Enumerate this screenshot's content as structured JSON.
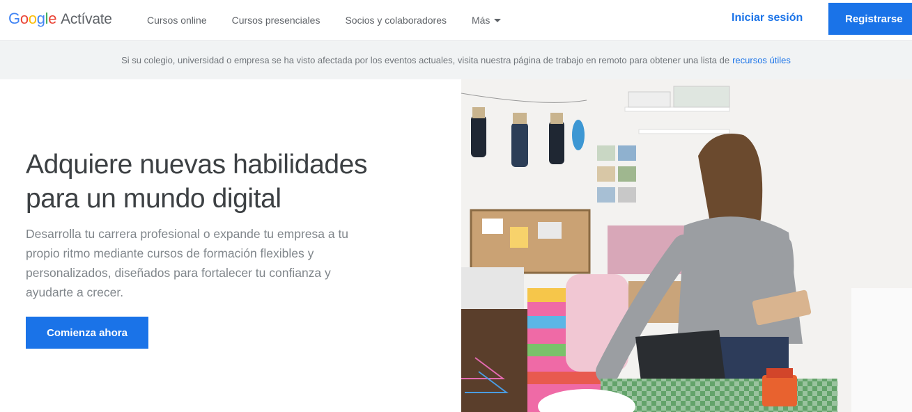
{
  "logo": {
    "letters": [
      "G",
      "o",
      "o",
      "g",
      "l",
      "e"
    ],
    "product": "Actívate"
  },
  "nav": {
    "items": [
      {
        "label": "Cursos online"
      },
      {
        "label": "Cursos presenciales"
      },
      {
        "label": "Socios y colaboradores"
      },
      {
        "label": "Más"
      }
    ],
    "signin_label": "Iniciar sesión",
    "register_label": "Registrarse"
  },
  "banner": {
    "text": "Si su colegio, universidad o empresa se ha visto afectada por los eventos actuales, visita nuestra página de trabajo en remoto para obtener una lista de",
    "link": "recursos útiles"
  },
  "hero": {
    "title_line1": "Adquiere nuevas habilidades",
    "title_line2": "para un mundo digital",
    "description": "Desarrolla tu carrera profesional o expande tu empresa a tu propio ritmo mediante cursos de formación flexibles y personalizados, diseñados para fortalecer tu confianza y ayudarte a crecer.",
    "cta_label": "Comienza ahora"
  },
  "colors": {
    "accent": "#1a73e8",
    "banner_bg": "#f1f3f4",
    "title": "#3c4043",
    "muted": "#80868b"
  },
  "icons": {
    "more_caret": "chevron-down-icon"
  }
}
